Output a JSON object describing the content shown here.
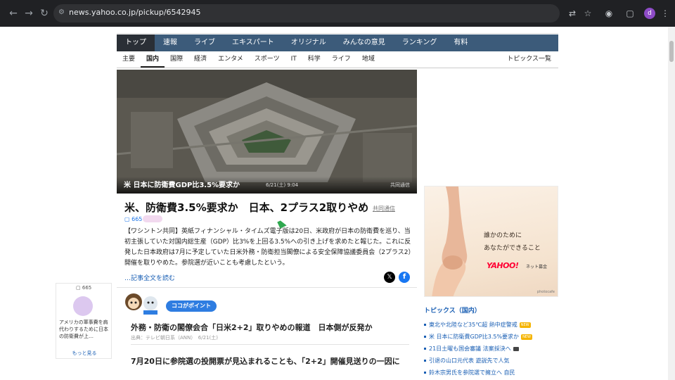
{
  "browser": {
    "url": "news.yahoo.co.jp/pickup/6542945",
    "profile_initial": "d"
  },
  "nav": {
    "main_tabs": [
      "トップ",
      "速報",
      "ライブ",
      "エキスパート",
      "オリジナル",
      "みんなの意見",
      "ランキング",
      "有料"
    ],
    "sub_tabs": [
      "主要",
      "国内",
      "国際",
      "経済",
      "エンタメ",
      "スポーツ",
      "IT",
      "科学",
      "ライフ",
      "地域"
    ],
    "topic_list_link": "トピックス一覧"
  },
  "hero": {
    "caption_title": "米 日本に防衛費GDP比3.5%要求か",
    "caption_date": "6/21(土) 9:04",
    "caption_credit": "共同通信"
  },
  "article": {
    "headline": "米、防衛費3.5%要求か　日本、2プラス2取りやめ",
    "source": "共同通信",
    "comment_count": "665",
    "body": "【ワシントン共同】英紙フィナンシャル・タイムズ電子版は20日、米政府が日本の防衛費を巡り、当初主張していた対国内総生産（GDP）比3%を上回る3.5%への引き上げを求めたと報じた。これに反発した日本政府は7月に予定していた日米外務・防衛担当閣僚による安全保障協議委員会（2プラス2）開催を取りやめた。参院選が近いことも考慮したという。",
    "read_more": "…記事全文を読む"
  },
  "point": {
    "badge": "ココがポイント",
    "item1_title": "外務・防衛の閣僚会合「日米2+2」取りやめの報道　日本側が反発か",
    "item1_meta": "出典：テレビ朝日系（ANN）　6/21(土)",
    "item2_title": "7月20日に参院選の投開票が見込まれることも、「2+2」開催見送りの一因に"
  },
  "left_card": {
    "count": "665",
    "text": "アメリカの軍事費を肩代わりするために日本の防衛費が上…",
    "more": "もっと見る"
  },
  "ad": {
    "line1": "誰かのために",
    "line2": "あなたができること",
    "logo": "YAHOO!",
    "fund_label": "ネット募金",
    "photo_credit": "photocafe"
  },
  "topics": {
    "heading": "トピックス（国内）",
    "items": [
      "東北や北陸など35℃超 熱中症警戒",
      "米 日本に防衛費GDP比3.5%要求か",
      "21日土曜も国会審議 法案採決へ",
      "引退の山口元代表 遊説先で人気",
      "鈴木宗男氏を参院選で擁立へ 自民"
    ],
    "new_badge": "NEW"
  }
}
